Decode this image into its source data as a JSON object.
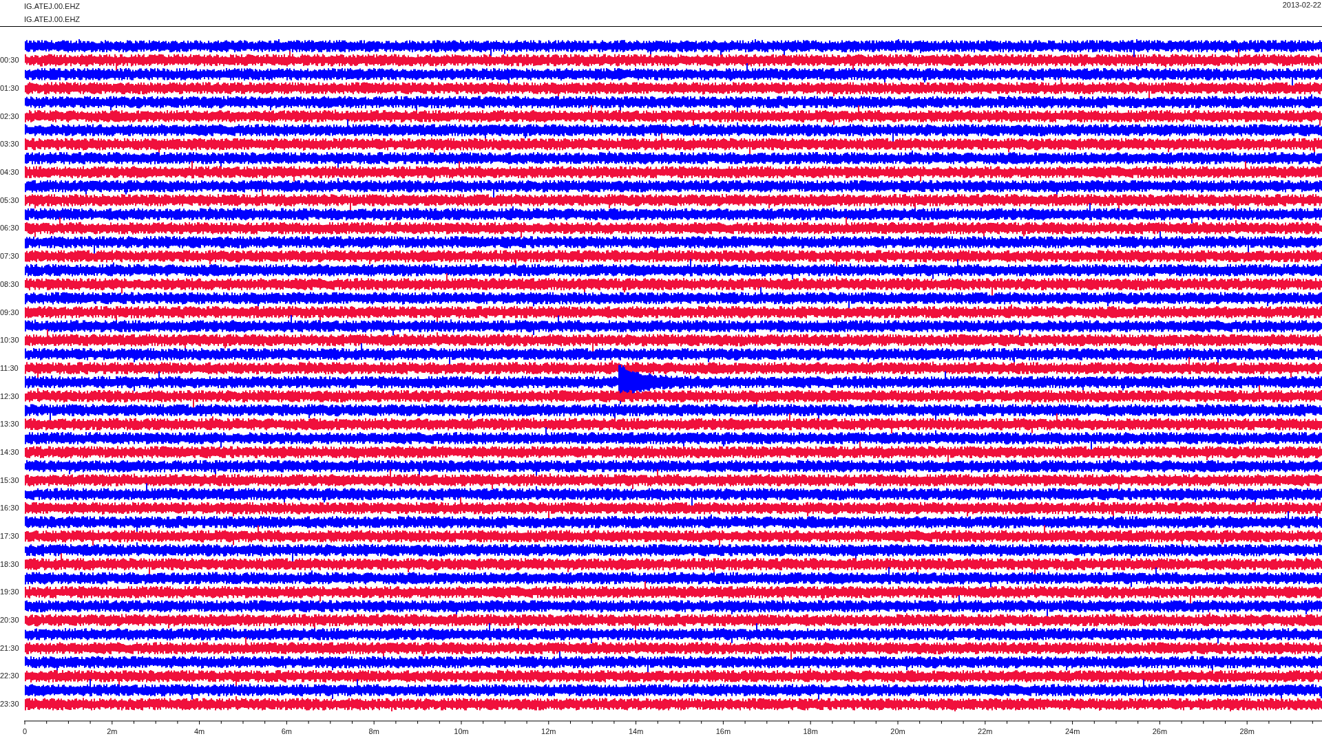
{
  "header": {
    "station_lines": [
      "IG.ATEJ.00.EHZ",
      "IG.ATEJ.00.EHZ"
    ],
    "date": "2013-02-22"
  },
  "row_labels": [
    "00:30",
    "01:30",
    "02:30",
    "03:30",
    "04:30",
    "05:30",
    "06:30",
    "07:30",
    "08:30",
    "09:30",
    "10:30",
    "11:30",
    "12:30",
    "13:30",
    "14:30",
    "15:30",
    "16:30",
    "17:30",
    "18:30",
    "19:30",
    "20:30",
    "21:30",
    "22:30",
    "23:30"
  ],
  "time_axis": {
    "tick_labels": [
      "0",
      "2m",
      "4m",
      "6m",
      "8m",
      "10m",
      "12m",
      "14m",
      "16m",
      "18m",
      "20m",
      "22m",
      "24m",
      "26m",
      "28m"
    ]
  }
}
